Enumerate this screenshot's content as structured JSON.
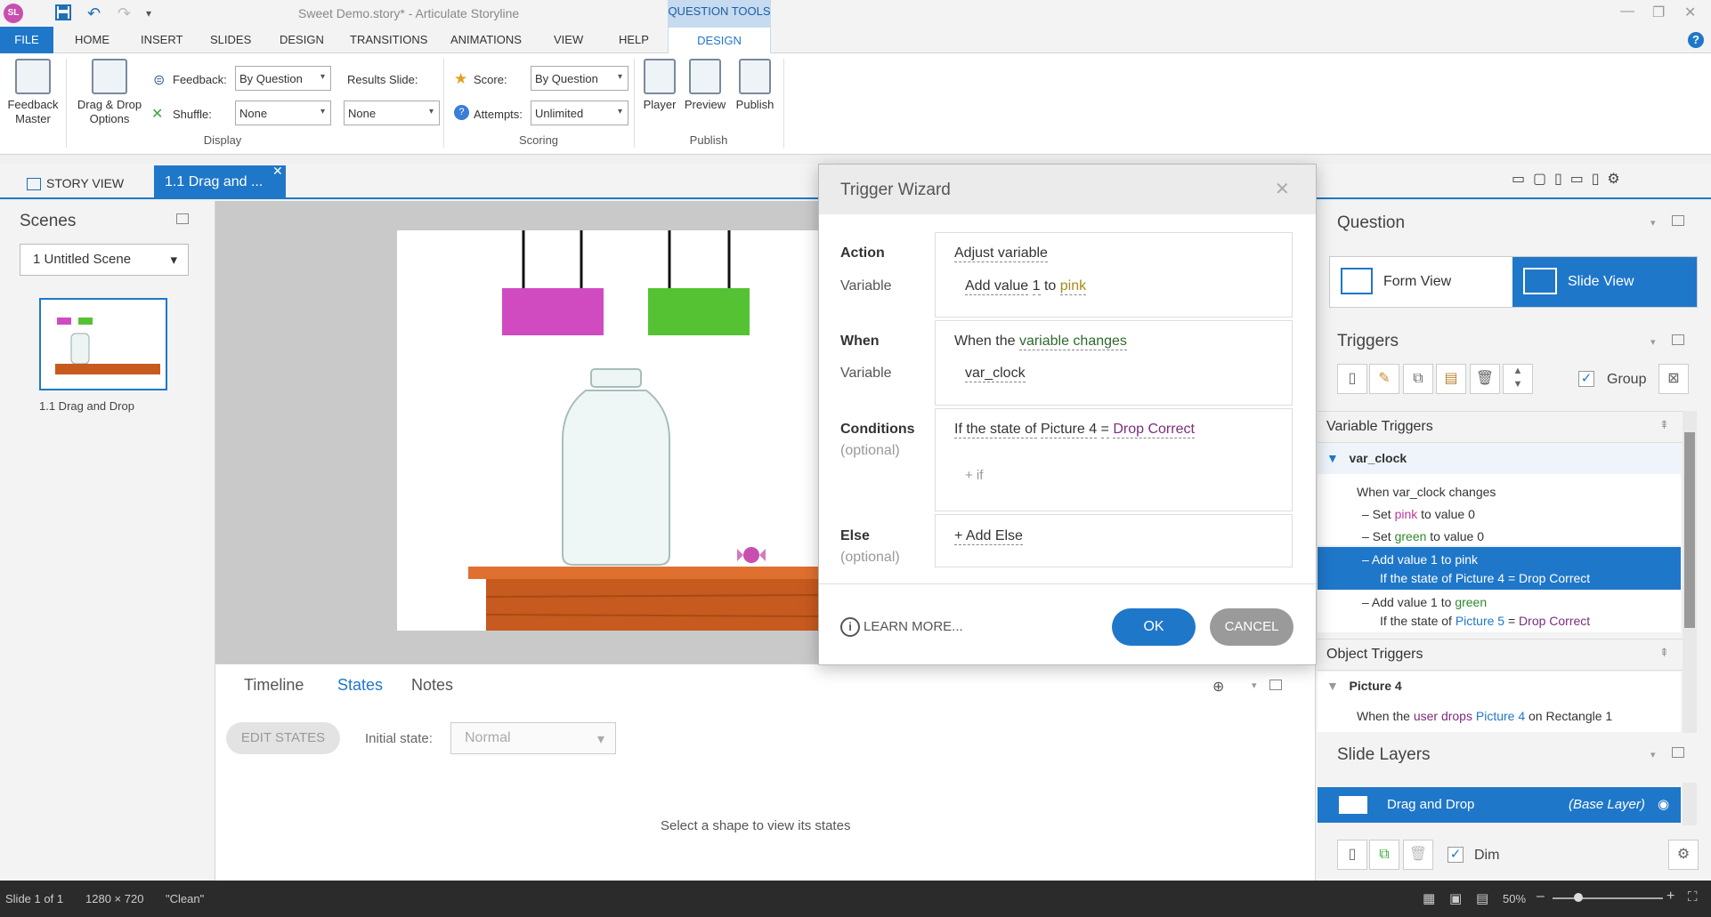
{
  "app": {
    "logo": "SL",
    "document_title": "Sweet Demo.story* - Articulate Storyline",
    "context_tab_group": "QUESTION TOOLS"
  },
  "ribbon_tabs": [
    "FILE",
    "HOME",
    "INSERT",
    "SLIDES",
    "DESIGN",
    "TRANSITIONS",
    "ANIMATIONS",
    "VIEW",
    "HELP",
    "DESIGN"
  ],
  "ribbon": {
    "feedback_master": "Feedback\nMaster",
    "drag_drop_options": "Drag & Drop\nOptions",
    "feedback_label": "Feedback:",
    "feedback_value": "By Question",
    "shuffle_label": "Shuffle:",
    "shuffle_value": "None",
    "results_slide_label": "Results Slide:",
    "results_slide_value": "None",
    "display_group": "Display",
    "score_label": "Score:",
    "score_value": "By Question",
    "attempts_label": "Attempts:",
    "attempts_value": "Unlimited",
    "scoring_group": "Scoring",
    "player": "Player",
    "preview": "Preview",
    "publish": "Publish",
    "publish_group": "Publish"
  },
  "view_tabs": {
    "story_view": "STORY VIEW",
    "slide_tab": "1.1 Drag and ..."
  },
  "scenes": {
    "title": "Scenes",
    "selected_scene": "1 Untitled Scene",
    "slide_label": "1.1 Drag and Drop"
  },
  "bottom": {
    "tabs": [
      "Timeline",
      "States",
      "Notes"
    ],
    "edit_states": "EDIT STATES",
    "initial_state_label": "Initial state:",
    "initial_state_value": "Normal",
    "hint": "Select a shape to view its states"
  },
  "dialog": {
    "title": "Trigger Wizard",
    "action_label": "Action",
    "action_value": "Adjust variable",
    "action_variable_label": "Variable",
    "action_variable_parts": [
      "Add value",
      "1",
      "to",
      "pink"
    ],
    "when_label": "When",
    "when_prefix": "When the",
    "when_value": "variable changes",
    "when_variable_label": "Variable",
    "when_variable_value": "var_clock",
    "conditions_label": "Conditions",
    "optional": "(optional)",
    "condition_parts": [
      "If the state of",
      "Picture 4",
      "=",
      "Drop Correct"
    ],
    "add_if": "+ if",
    "else_label": "Else",
    "add_else": "+ Add Else",
    "learn_more": "LEARN MORE...",
    "ok": "OK",
    "cancel": "CANCEL"
  },
  "right_panel": {
    "question_title": "Question",
    "form_view": "Form View",
    "slide_view": "Slide View",
    "triggers_title": "Triggers",
    "group_label": "Group",
    "variable_triggers": "Variable Triggers",
    "var_name": "var_clock",
    "trig_when": "When var_clock changes",
    "trig1": [
      "– Set",
      "pink",
      "to value 0"
    ],
    "trig2": [
      "– Set",
      "green",
      "to value 0"
    ],
    "trig3": [
      "– Add value 1 to",
      "pink"
    ],
    "trig3_cond": [
      "If the state of",
      "Picture 4",
      "=",
      "Drop Correct"
    ],
    "trig4": [
      "– Add value 1 to",
      "green"
    ],
    "trig4_cond": [
      "If the state of",
      "Picture 5",
      "=",
      "Drop Correct"
    ],
    "object_triggers": "Object Triggers",
    "obj_name": "Picture 4",
    "obj_trig": [
      "When the",
      "user drops",
      "Picture 4",
      "on Rectangle 1"
    ],
    "slide_layers_title": "Slide Layers",
    "layer_name": "Drag and Drop",
    "layer_type": "(Base Layer)",
    "dim_label": "Dim"
  },
  "status": {
    "slide": "Slide 1 of 1",
    "size": "1280 × 720",
    "theme": "\"Clean\"",
    "zoom": "50%"
  },
  "colors": {
    "accent": "#1f77c9",
    "pink_box": "#d04bc0",
    "green_box": "#55c234",
    "table": "#c75a1f"
  }
}
